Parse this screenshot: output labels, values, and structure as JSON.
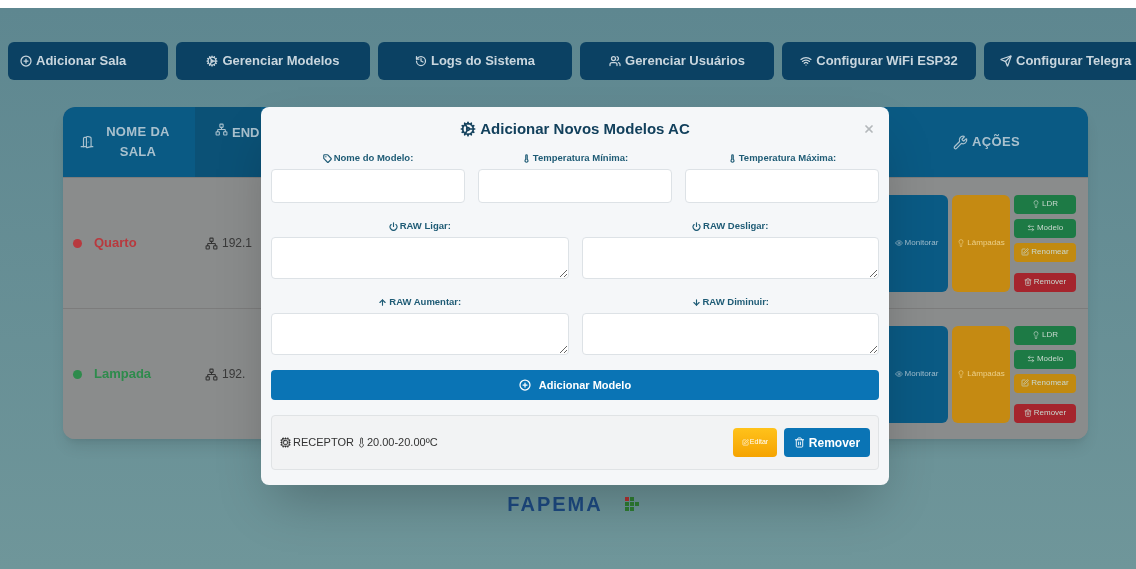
{
  "nav_buttons": [
    {
      "label": "Adicionar Sala"
    },
    {
      "label": "Gerenciar Modelos"
    },
    {
      "label": "Logs do Sistema"
    },
    {
      "label": "Gerenciar Usuários"
    },
    {
      "label": "Configurar WiFi ESP32"
    },
    {
      "label": "Configurar Telegra"
    }
  ],
  "table": {
    "columns": [
      {
        "label": "NOME DA SALA"
      },
      {
        "label": "END"
      },
      {
        "label": "AÇÕES"
      }
    ],
    "rows": [
      {
        "name": "Quarto",
        "color": "#b8393e",
        "ip": "192.1",
        "monitor": "Monitorar",
        "lamps": "Lâmpadas",
        "actions": [
          {
            "label": "LDR",
            "kind": "ldr"
          },
          {
            "label": "Modelo",
            "kind": "model"
          },
          {
            "label": "Renomear",
            "kind": "rename"
          },
          {
            "label": "Remover",
            "kind": "remove"
          }
        ]
      },
      {
        "name": "Lampada",
        "color": "#2e8b4c",
        "ip": "192.",
        "monitor": "Monitorar",
        "lamps": "Lâmpadas",
        "actions": [
          {
            "label": "LDR",
            "kind": "ldr"
          },
          {
            "label": "Modelo",
            "kind": "model"
          },
          {
            "label": "Renomear",
            "kind": "rename"
          },
          {
            "label": "Remover",
            "kind": "remove"
          }
        ]
      }
    ]
  },
  "modal": {
    "title": "Adicionar Novos Modelos AC",
    "field_rows": [
      [
        {
          "label": "Nome do Modelo:",
          "kind": "input"
        },
        {
          "label": "Temperatura Mínima:",
          "kind": "input"
        },
        {
          "label": "Temperatura Máxima:",
          "kind": "input"
        }
      ],
      [
        {
          "label": "RAW Ligar:",
          "kind": "textarea"
        },
        {
          "label": "RAW Desligar:",
          "kind": "textarea"
        }
      ],
      [
        {
          "label": "RAW Aumentar:",
          "kind": "textarea"
        },
        {
          "label": "RAW Diminuir:",
          "kind": "textarea"
        }
      ]
    ],
    "submit": "Adicionar Modelo",
    "models": [
      {
        "type": "RECEPTOR",
        "range": "20.00-20.00ºC",
        "edit": "Editar",
        "remove": "Remover"
      }
    ]
  },
  "footer": {
    "logo": "FAPEMA"
  }
}
